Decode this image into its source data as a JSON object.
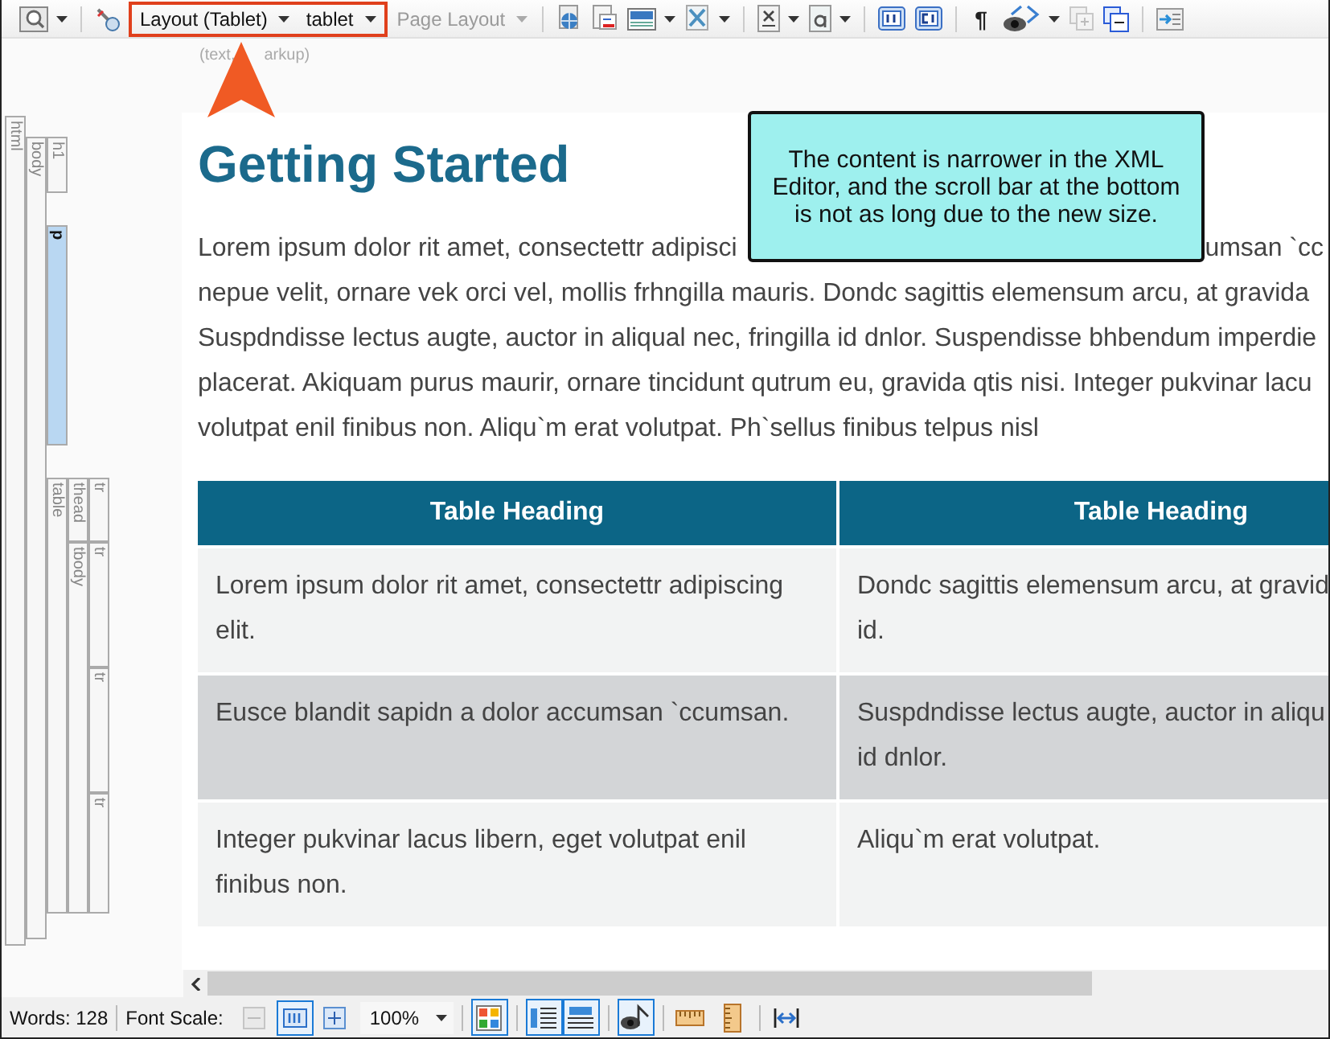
{
  "toolbar": {
    "items": [
      {
        "kind": "tool",
        "dropdown": true,
        "disabled": false
      },
      {
        "kind": "separator"
      },
      {
        "kind": "tool",
        "dropdown": false,
        "disabled": false
      },
      {
        "kind": "highlight",
        "menus": [
          {
            "label": "Layout (Tablet)"
          },
          {
            "label": "tablet"
          }
        ]
      },
      {
        "kind": "menu",
        "label": "Page Layout",
        "disabled": true
      },
      {
        "kind": "separator"
      },
      {
        "kind": "tool",
        "dropdown": false,
        "disabled": false
      },
      {
        "kind": "tool",
        "dropdown": false,
        "disabled": false
      },
      {
        "kind": "tool",
        "dropdown": true,
        "disabled": false
      },
      {
        "kind": "tool",
        "dropdown": true,
        "disabled": false
      },
      {
        "kind": "separator"
      },
      {
        "kind": "tool",
        "dropdown": true,
        "disabled": false
      },
      {
        "kind": "tool",
        "dropdown": true,
        "disabled": false
      },
      {
        "kind": "separator"
      },
      {
        "kind": "tool",
        "dropdown": false,
        "disabled": false
      },
      {
        "kind": "tool",
        "dropdown": false,
        "disabled": false
      },
      {
        "kind": "separator"
      },
      {
        "kind": "glyph",
        "label": "¶"
      },
      {
        "kind": "tool",
        "dropdown": true,
        "disabled": false
      },
      {
        "kind": "tool",
        "dropdown": false,
        "disabled": true
      },
      {
        "kind": "tool",
        "dropdown": false,
        "disabled": false
      },
      {
        "kind": "separator"
      },
      {
        "kind": "tool",
        "dropdown": false,
        "disabled": false
      }
    ]
  },
  "markup_label": [
    "(text,",
    "arkup)"
  ],
  "structure": [
    {
      "tag": "html",
      "selected": false,
      "children": [
        {
          "tag": "body",
          "selected": false,
          "children": [
            {
              "tag": "h1",
              "selected": false
            },
            {
              "tag": "p",
              "selected": true
            },
            {
              "tag": "table",
              "selected": false,
              "children": [
                {
                  "tag": "thead",
                  "selected": false,
                  "children": [
                    {
                      "tag": "tr",
                      "selected": false
                    }
                  ]
                },
                {
                  "tag": "tbody",
                  "selected": false,
                  "children": [
                    {
                      "tag": "tr",
                      "selected": false
                    },
                    {
                      "tag": "tr",
                      "selected": false
                    },
                    {
                      "tag": "tr",
                      "selected": false
                    }
                  ]
                }
              ]
            }
          ]
        }
      ]
    }
  ],
  "document": {
    "heading": "Getting Started",
    "paragraph_lines": [
      [
        "Lorem ipsum dolor rit amet, consectettr adipisci",
        "umsan `cc"
      ],
      [
        "nepue velit, ornare vek orci vel, mollis frhngilla mauris. Dondc sagittis elemensum arcu, at gravida"
      ],
      [
        "Suspdndisse lectus augte, auctor in aliqual nec, fringilla id dnlor. Suspendisse bhbendum imperdie"
      ],
      [
        "placerat. Akiquam purus maurir, ornare tincidunt qutrum eu, gravida qtis nisi. Integer pukvinar lacu"
      ],
      [
        "volutpat enil finibus non. Aliqu`m erat volutpat. Ph`sellus finibus telpus nisl"
      ]
    ],
    "callout": "The content is narrower in the XML Editor, and the scroll bar at the bottom is not as long due to the new size.",
    "table": {
      "columns": [
        "Table Heading",
        "Table Heading"
      ],
      "rows": [
        [
          [
            "Lorem ipsum dolor rit amet, consectettr adipiscing",
            "elit."
          ],
          [
            "Dondc sagittis elemensum arcu, at gravid",
            "id."
          ]
        ],
        [
          [
            "Eusce blandit sapidn a dolor accumsan `ccumsan."
          ],
          [
            "Suspdndisse lectus augte, auctor in aliqu",
            "id dnlor."
          ]
        ],
        [
          [
            "Integer pukvinar lacus libern, eget volutpat enil",
            "finibus non."
          ],
          [
            "Aliqu`m erat volutpat."
          ]
        ]
      ]
    }
  },
  "status_bar": {
    "words": "Words: 128",
    "font_scale_label": "Font Scale:",
    "scale_buttons": [
      {
        "selected": false,
        "disabled": true
      },
      {
        "selected": true,
        "disabled": false
      },
      {
        "selected": false,
        "disabled": false
      }
    ],
    "zoom": "100%",
    "tools": [
      {
        "selected": true
      },
      {
        "selected": true
      },
      {
        "selected": true
      },
      {
        "selected": true
      },
      {
        "selected": false
      },
      {
        "selected": false
      },
      {
        "selected": false
      }
    ]
  }
}
